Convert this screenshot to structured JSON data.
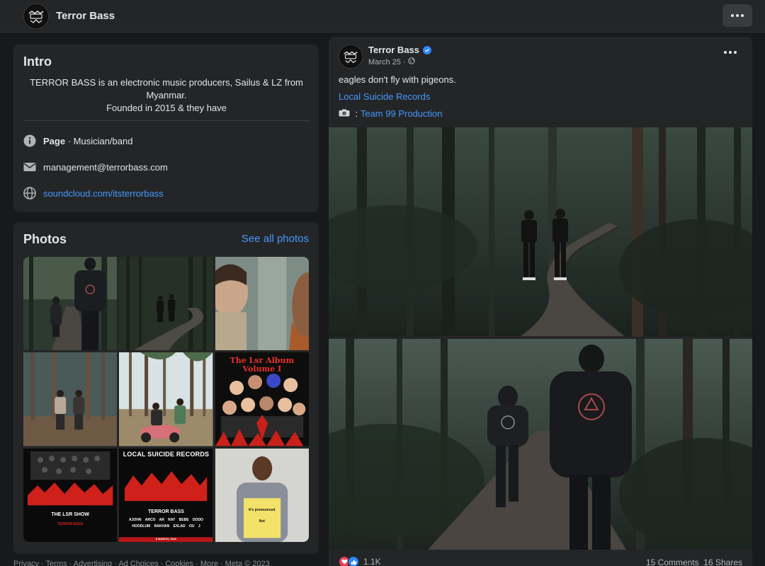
{
  "header": {
    "page_name": "Terror Bass",
    "logo_icon": "terror-bass-logo-icon",
    "more_icon": "more-dots-icon"
  },
  "intro": {
    "title": "Intro",
    "bio_line1": "TERROR BASS is an electronic music producers, Sailus & LZ from",
    "bio_line2": "Myanmar.",
    "bio_line3": "Founded in 2015 & they have",
    "page_type_bold": "Page",
    "page_type_rest": " · Musician/band",
    "email": "management@terrorbass.com",
    "website": "soundcloud.com/itsterrorbass",
    "icons": [
      "info-icon",
      "mail-icon",
      "globe-icon"
    ]
  },
  "photos": {
    "title": "Photos",
    "see_all": "See all photos",
    "album_title_line1": "The Lsr Album",
    "album_title_line2": "Volume I",
    "show_band": "LOCAL SUICIDE",
    "show_name": "THE LSR SHOW",
    "show_sub": "TERROR BASS",
    "records_title": "LOCAL SUICIDE RECORDS",
    "records_artist": "TERROR BASS",
    "lineup_row1": [
      "AJOHN",
      "ARCO",
      "AR RAY",
      "BEBE",
      "DODO"
    ],
    "lineup_row2": [
      "HOODLUM",
      "RAKHAN",
      "EXLAD",
      "OU J"
    ],
    "records_date": "8 MARCH, 2022",
    "sign_line1": "It's pronounced",
    "sign_line2": "Not"
  },
  "post": {
    "author": "Terror Bass",
    "date": "March 25 ·",
    "text": "eagles don't fly with pigeons.",
    "link": "Local Suicide Records",
    "credit_prefix": " : ",
    "credit_link": "Team 99 Production",
    "reaction_count": "1.1K",
    "stats": "15 Comments  16 Shares"
  },
  "footer": {
    "text": "Privacy · Terms · Advertising · Ad Choices · Cookies · More · Meta © 2023"
  },
  "colors": {
    "background": "#18191a",
    "card": "#242526",
    "link": "#4599ff",
    "verified": "#2d88ff",
    "love": "#f33e58"
  }
}
